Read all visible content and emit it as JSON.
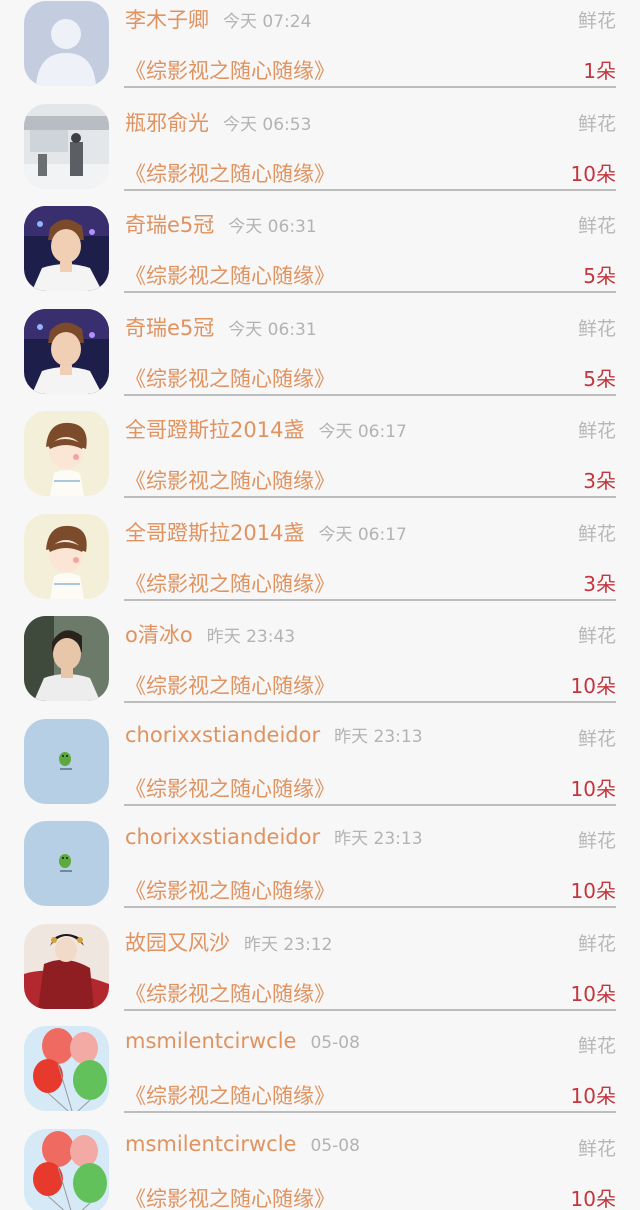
{
  "gift_list": {
    "items": [
      {
        "name": "李木子卿",
        "time": "今天 07:24",
        "gift": "鲜花",
        "book": "《综影视之随心随缘》",
        "count": "1朵",
        "avatar": "default-avatar"
      },
      {
        "name": "瓶邪俞光",
        "time": "今天 06:53",
        "gift": "鲜花",
        "book": "《综影视之随心随缘》",
        "count": "10朵",
        "avatar": "winter-figure"
      },
      {
        "name": "奇瑞e5冠",
        "time": "今天 06:31",
        "gift": "鲜花",
        "book": "《综影视之随心随缘》",
        "count": "5朵",
        "avatar": "stage-boy"
      },
      {
        "name": "奇瑞e5冠",
        "time": "今天 06:31",
        "gift": "鲜花",
        "book": "《综影视之随心随缘》",
        "count": "5朵",
        "avatar": "stage-boy"
      },
      {
        "name": "全哥蹬斯拉2014盏",
        "time": "今天 06:17",
        "gift": "鲜花",
        "book": "《综影视之随心随缘》",
        "count": "3朵",
        "avatar": "cartoon-boy"
      },
      {
        "name": "全哥蹬斯拉2014盏",
        "time": "今天 06:17",
        "gift": "鲜花",
        "book": "《综影视之随心随缘》",
        "count": "3朵",
        "avatar": "cartoon-boy"
      },
      {
        "name": "o清冰o",
        "time": "昨天 23:43",
        "gift": "鲜花",
        "book": "《综影视之随心随缘》",
        "count": "10朵",
        "avatar": "portrait-man"
      },
      {
        "name": "chorixxstiandeidor",
        "time": "昨天 23:13",
        "gift": "鲜花",
        "book": "《综影视之随心随缘》",
        "count": "10朵",
        "avatar": "green-chick"
      },
      {
        "name": "chorixxstiandeidor",
        "time": "昨天 23:13",
        "gift": "鲜花",
        "book": "《综影视之随心随缘》",
        "count": "10朵",
        "avatar": "green-chick"
      },
      {
        "name": "故园又风沙",
        "time": "昨天 23:12",
        "gift": "鲜花",
        "book": "《综影视之随心随缘》",
        "count": "10朵",
        "avatar": "red-costume"
      },
      {
        "name": "msmilentcirwcle",
        "time": "05-08",
        "gift": "鲜花",
        "book": "《综影视之随心随缘》",
        "count": "10朵",
        "avatar": "balloons"
      },
      {
        "name": "msmilentcirwcle",
        "time": "05-08",
        "gift": "鲜花",
        "book": "《综影视之随心随缘》",
        "count": "10朵",
        "avatar": "balloons"
      }
    ]
  },
  "colors": {
    "name": "#e0925f",
    "count": "#c3363e",
    "muted": "#b3b3b3",
    "background": "#f7f7f7"
  }
}
